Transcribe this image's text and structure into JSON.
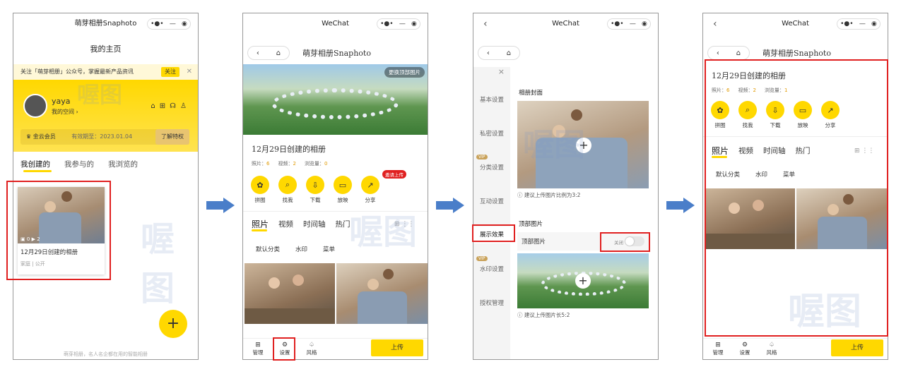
{
  "p1": {
    "title": "萌芽相册Snaphoto",
    "heading": "我的主页",
    "banner": "关注「萌芽相册」公众号，掌握最新产品资讯",
    "follow": "关注",
    "close": "✕",
    "username": "yaya",
    "myspace": "我的空间 ›",
    "vip": "金云会员",
    "expiry": "有效期至：2023.01.04",
    "privilege": "了解特权",
    "tabs": [
      "我创建的",
      "我参与的",
      "我浏览的"
    ],
    "album_title": "12月29日创建的相册",
    "album_meta": "家庭 | 公开",
    "count_a": "0",
    "count_b": "2",
    "fab": "+",
    "footer": "萌芽相册，名人名企都在用的智能相册"
  },
  "p2": {
    "title": "WeChat",
    "appname": "萌芽相册Snaphoto",
    "change_top": "更换顶部图片",
    "album_title": "12月29日创建的相册",
    "stats": [
      {
        "k": "照片：",
        "v": "6"
      },
      {
        "k": "视频：",
        "v": "2"
      },
      {
        "k": "浏览量：",
        "v": "0"
      }
    ],
    "invite": "邀请上传",
    "actions": [
      "拼图",
      "找我",
      "下载",
      "放映",
      "分享"
    ],
    "action_icons": [
      "✿",
      "⌕",
      "⇩",
      "▭",
      "↗"
    ],
    "tabs": [
      "照片",
      "视频",
      "时间轴",
      "热门"
    ],
    "subtabs": [
      "默认分类",
      "水印",
      "菜单"
    ],
    "bottom": [
      "管理",
      "设置",
      "风格"
    ],
    "bottom_icons": [
      "⊞",
      "⚙",
      "♤"
    ],
    "upload": "上传"
  },
  "p3": {
    "title": "WeChat",
    "close": "×",
    "menu": [
      "基本设置",
      "私密设置",
      "分类设置",
      "互动设置",
      "展示效果",
      "水印设置",
      "授权管理"
    ],
    "vip": "VIP",
    "cover_title": "相册封面",
    "cover_tip": "ⓘ 建议上传图片比例为3:2",
    "top_title": "顶部图片",
    "top_label": "顶部图片",
    "toggle": "关闭",
    "top_tip": "ⓘ 建议上传图片长5:2",
    "plus": "+"
  },
  "p4": {
    "title": "WeChat",
    "appname": "萌芽相册Snaphoto",
    "album_title": "12月29日创建的相册",
    "stats": [
      {
        "k": "照片：",
        "v": "6"
      },
      {
        "k": "视频：",
        "v": "2"
      },
      {
        "k": "浏览量：",
        "v": "1"
      }
    ],
    "actions": [
      "拼图",
      "找我",
      "下载",
      "放映",
      "分享"
    ],
    "action_icons": [
      "✿",
      "⌕",
      "⇩",
      "▭",
      "↗"
    ],
    "tabs": [
      "照片",
      "视频",
      "时间轴",
      "热门"
    ],
    "subtabs": [
      "默认分类",
      "水印",
      "菜单"
    ],
    "bottom": [
      "管理",
      "设置",
      "风格"
    ],
    "bottom_icons": [
      "⊞",
      "⚙",
      "♤"
    ],
    "upload": "上传"
  },
  "watermark": "喔图",
  "colors": {
    "accent": "#ffd800",
    "red": "#e02020",
    "arrow": "#4a7ec9"
  }
}
